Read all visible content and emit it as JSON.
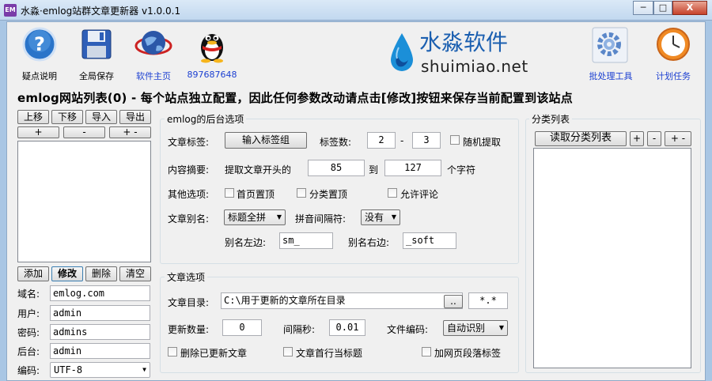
{
  "window": {
    "icon_text": "EM",
    "title": "水淼·emlog站群文章更新器 v1.0.0.1",
    "minimize": "─",
    "restore": "□",
    "close": "X"
  },
  "toolbar": {
    "help": "疑点说明",
    "save_all": "全局保存",
    "homepage": "软件主页",
    "qq": "897687648",
    "batch_tools": "批处理工具",
    "schedule": "计划任务",
    "brand_cn": "水淼软件",
    "brand_en": "shuimiao.net"
  },
  "heading": "emlog网站列表(0) - 每个站点独立配置，因此任何参数改动请点击[修改]按钮来保存当前配置到该站点",
  "site_list": {
    "move_up": "上移",
    "move_down": "下移",
    "import": "导入",
    "export": "导出",
    "plus": "+",
    "minus": "-",
    "plus_minus": "+ -",
    "add": "添加",
    "modify": "修改",
    "delete": "删除",
    "clear": "清空",
    "domain_label": "域名:",
    "domain": "emlog.com",
    "user_label": "用户:",
    "user": "admin",
    "password_label": "密码:",
    "password": "admins",
    "backend_label": "后台:",
    "backend": "admin",
    "encoding_label": "编码:",
    "encoding": "UTF-8"
  },
  "backend_options": {
    "title": "emlog的后台选项",
    "tags_label": "文章标签:",
    "input_tags_button": "输入标签组",
    "tag_count_label": "标签数:",
    "tag_min": "2",
    "dash": "-",
    "tag_max": "3",
    "random_pick": "随机提取",
    "summary_label": "内容摘要:",
    "summary_prefix": "提取文章开头的",
    "summary_min": "85",
    "summary_to": "到",
    "summary_max": "127",
    "summary_suffix": "个字符",
    "other_label": "其他选项:",
    "top_home": "首页置顶",
    "top_category": "分类置顶",
    "allow_comment": "允许评论",
    "alias_label": "文章别名:",
    "alias_mode": "标题全拼",
    "pinyin_sep_label": "拼音间隔符:",
    "pinyin_sep": "没有",
    "alias_left_label": "别名左边:",
    "alias_left": "sm_",
    "alias_right_label": "别名右边:",
    "alias_right": "_soft"
  },
  "article_options": {
    "title": "文章选项",
    "dir_label": "文章目录:",
    "dir": "C:\\用于更新的文章所在目录",
    "browse": "..",
    "pattern": "*.*",
    "update_count_label": "更新数量:",
    "update_count": "0",
    "interval_label": "间隔秒:",
    "interval": "0.01",
    "file_encoding_label": "文件编码:",
    "file_encoding": "自动识别",
    "delete_updated": "删除已更新文章",
    "first_line_title": "文章首行当标题",
    "add_paragraph_tags": "加网页段落标签"
  },
  "category_list": {
    "title": "分类列表",
    "read_button": "读取分类列表",
    "plus": "+",
    "minus": "-",
    "plus_minus": "+ -"
  },
  "colors": {
    "link_blue": "#1b3fd1",
    "window_frame": "#a9c6e4",
    "panel_bg": "#f0f0f0"
  }
}
